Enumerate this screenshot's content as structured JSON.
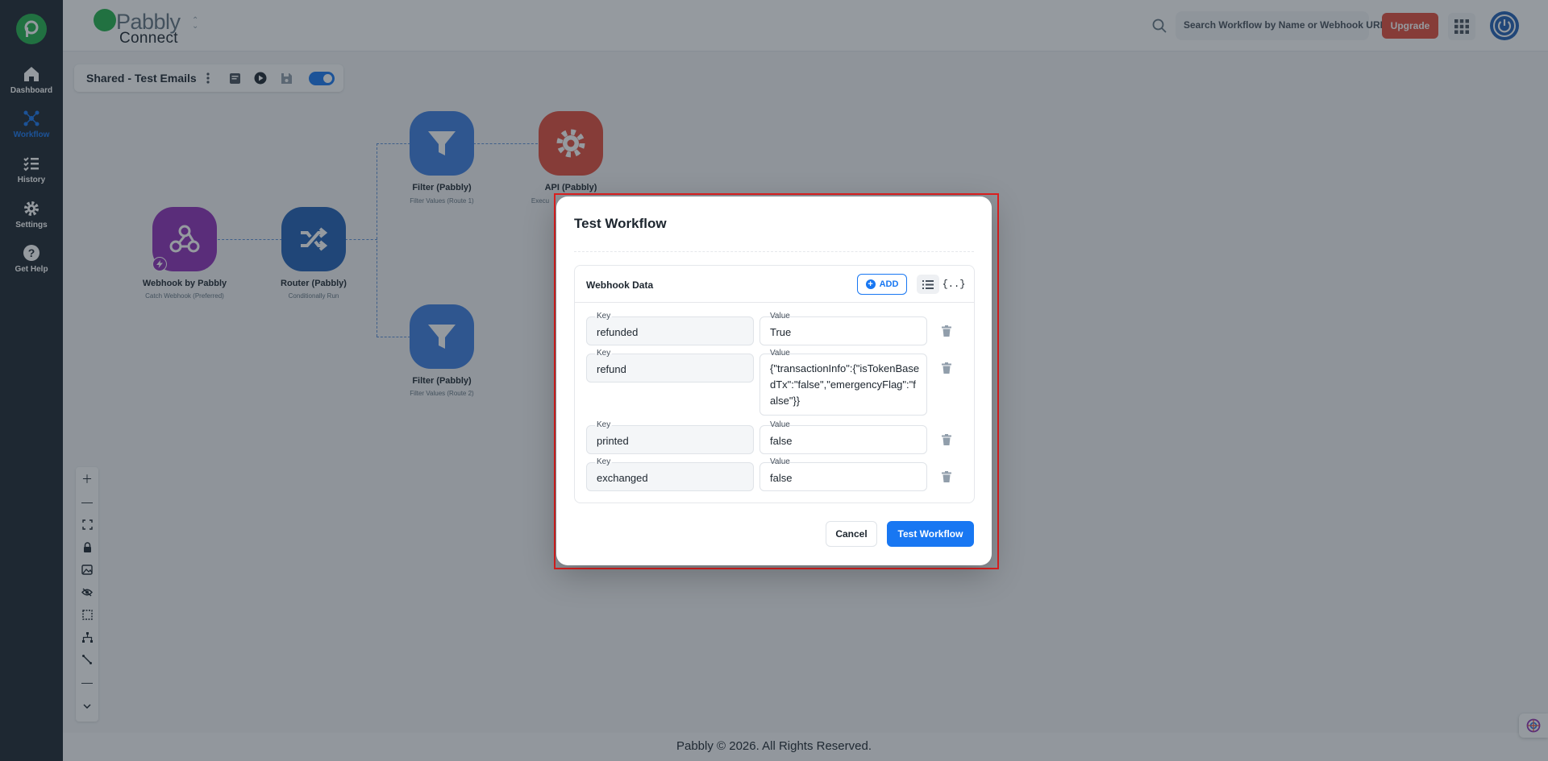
{
  "sidebar": {
    "items": [
      {
        "label": "Dashboard",
        "icon": "home-icon"
      },
      {
        "label": "Workflow",
        "icon": "workflow-icon",
        "active": true
      },
      {
        "label": "History",
        "icon": "history-icon"
      },
      {
        "label": "Settings",
        "icon": "gear-icon"
      },
      {
        "label": "Get Help",
        "icon": "help-icon"
      }
    ]
  },
  "header": {
    "brand_name": "Pabbly",
    "brand_sub": "Connect",
    "search_placeholder": "Search Workflow by Name or Webhook URL",
    "upgrade_label": "Upgrade"
  },
  "workflow": {
    "name": "Shared - Test Emails",
    "enabled": true
  },
  "nodes": [
    {
      "title": "Webhook by Pabbly",
      "subtitle": "Catch Webhook (Preferred)",
      "color": "#8e2fb8"
    },
    {
      "title": "Router (Pabbly)",
      "subtitle": "Conditionally Run",
      "color": "#1f5fb5"
    },
    {
      "title": "Filter (Pabbly)",
      "subtitle": "Filter Values (Route 1)",
      "color": "#3d7ee0"
    },
    {
      "title": "API (Pabbly)",
      "subtitle": "Execu",
      "color": "#e24c3b"
    },
    {
      "title": "Filter (Pabbly)",
      "subtitle": "Filter Values (Route 2)",
      "color": "#3d7ee0"
    }
  ],
  "modal": {
    "title": "Test Workflow",
    "section_title": "Webhook Data",
    "add_label": "ADD",
    "json_toggle_label": "{..}",
    "key_label": "Key",
    "value_label": "Value",
    "rows": [
      {
        "key": "refunded",
        "value": "True"
      },
      {
        "key": "refund",
        "value": "{\"transactionInfo\":{\"isTokenBasedTx\":\"false\",\"emergencyFlag\":\"false\"}}"
      },
      {
        "key": "printed",
        "value": "false"
      },
      {
        "key": "exchanged",
        "value": "false"
      }
    ],
    "cancel_label": "Cancel",
    "submit_label": "Test Workflow"
  },
  "footer": {
    "text": "Pabbly © 2026. All Rights Reserved."
  },
  "colors": {
    "accent": "#1877f2",
    "upgrade": "#e24c3b",
    "sidebar_bg": "#1c252e",
    "highlight": "#e02020"
  }
}
